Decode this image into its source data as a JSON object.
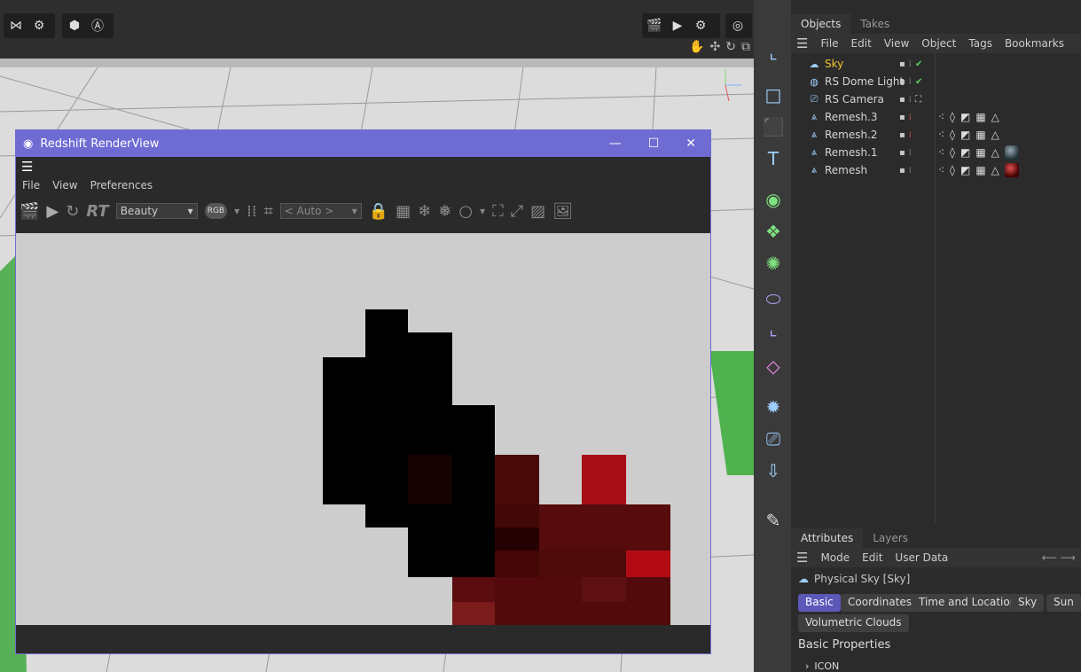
{
  "objects_panel": {
    "tabs": [
      "Objects",
      "Takes"
    ],
    "menu": [
      "File",
      "Edit",
      "View",
      "Object",
      "Tags",
      "Bookmarks"
    ],
    "rows": [
      {
        "name": "Sky",
        "selected": true
      },
      {
        "name": "RS Dome Light"
      },
      {
        "name": "RS Camera"
      },
      {
        "name": "Remesh.3"
      },
      {
        "name": "Remesh.2"
      },
      {
        "name": "Remesh.1"
      },
      {
        "name": "Remesh"
      }
    ]
  },
  "attributes": {
    "tabs": [
      "Attributes",
      "Layers"
    ],
    "menu": [
      "Mode",
      "Edit",
      "User Data"
    ],
    "object_title": "Physical Sky [Sky]",
    "sections": [
      "Basic",
      "Coordinates",
      "Time and Location",
      "Sky",
      "Sun",
      "Volumetric Clouds"
    ],
    "heading": "Basic Properties",
    "group": "ICON"
  },
  "renderview": {
    "title": "Redshift RenderView",
    "menu": [
      "File",
      "View",
      "Preferences"
    ],
    "aov": "Beauty",
    "channel": "RGB",
    "rt": "RT",
    "auto": "< Auto >"
  },
  "colors": {
    "accent": "#6e6bd3",
    "selected_name": "#f0c330"
  }
}
